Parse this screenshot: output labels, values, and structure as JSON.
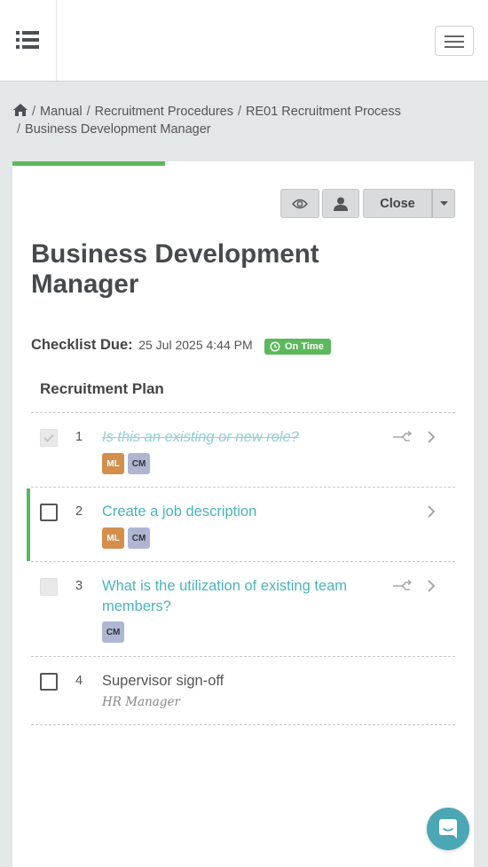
{
  "topbar": {
    "list_icon": "list-icon",
    "menu_icon": "hamburger-menu-icon"
  },
  "breadcrumb": {
    "home_icon": "home-icon",
    "items": [
      "Manual",
      "Recruitment Procedures",
      "RE01 Recruitment Process",
      "Business Development Manager"
    ]
  },
  "progress": {
    "fraction": 0.33,
    "color": "#5cb85c"
  },
  "toolbar": {
    "eye_icon": "eye-icon",
    "user_icon": "user-icon",
    "close_label": "Close",
    "caret_icon": "caret-down-icon"
  },
  "page": {
    "title": "Business Development Manager",
    "due_label": "Checklist Due:",
    "due_value": "25 Jul 2025 4:44 PM",
    "status_badge": "On Time",
    "section_title": "Recruitment Plan"
  },
  "tasks": [
    {
      "number": "1",
      "name": "Is this an existing or new role?",
      "state": "completed",
      "avatars": [
        "ML",
        "CM"
      ],
      "has_branch": true
    },
    {
      "number": "2",
      "name": "Create a job description",
      "state": "active",
      "avatars": [
        "ML",
        "CM"
      ],
      "has_branch": false
    },
    {
      "number": "3",
      "name": "What is the utilization of existing team members?",
      "state": "disabled",
      "avatars": [
        "CM"
      ],
      "has_branch": true
    },
    {
      "number": "4",
      "name": "Supervisor sign-off",
      "state": "pending",
      "subtitle": "HR Manager",
      "avatars": [],
      "has_branch": false
    }
  ],
  "colors": {
    "accent_green": "#5cb85c",
    "link_teal": "#4bb3bc",
    "avatar_ml": "#d38f4b",
    "avatar_cm": "#aeb6d4",
    "chat_button": "#4aa7b3"
  },
  "chat": {
    "icon": "chat-bubble-icon"
  }
}
